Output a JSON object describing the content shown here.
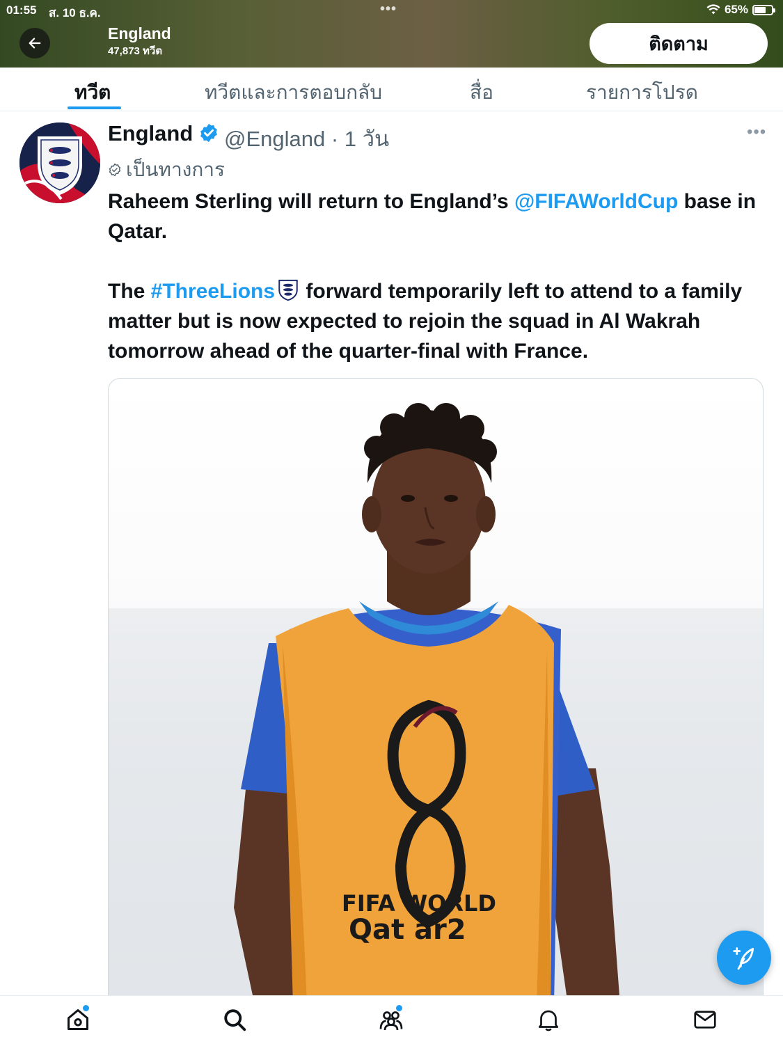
{
  "status_bar": {
    "time": "01:55",
    "date": "ส. 10 ธ.ค.",
    "battery": "65%",
    "battery_level": 0.65
  },
  "header": {
    "title": "England",
    "tweet_count": "47,873 ทวีต",
    "follow_label": "ติดตาม"
  },
  "tabs": [
    {
      "label": "ทวีต",
      "active": true
    },
    {
      "label": "ทวีตและการตอบกลับ",
      "active": false
    },
    {
      "label": "สื่อ",
      "active": false
    },
    {
      "label": "รายการโปรด",
      "active": false
    }
  ],
  "tweet": {
    "name": "England",
    "handle_time": "@England · 1 วัน",
    "official_label": "เป็นทางการ",
    "text_1a": "Raheem Sterling will return to England’s ",
    "mention": "@FIFAWorldCup",
    "text_1b": " base in Qatar.",
    "text_2a": "The ",
    "hashtag": "#ThreeLions",
    "text_2b": " forward temporarily left to attend to a family matter but is now expected to rejoin the squad in Al Wakrah tomorrow ahead of the quarter-final with France.",
    "media_bib_line1": "FIFA WORLD",
    "media_bib_line2": "Qat ar2"
  },
  "colors": {
    "accent": "#1d9bf0",
    "text": "#0f1419",
    "secondary": "#536471"
  },
  "bottom_nav": [
    {
      "icon": "home-icon",
      "notification": true
    },
    {
      "icon": "search-icon",
      "notification": false
    },
    {
      "icon": "communities-icon",
      "notification": true
    },
    {
      "icon": "bell-icon",
      "notification": false
    },
    {
      "icon": "mail-icon",
      "notification": false
    }
  ]
}
